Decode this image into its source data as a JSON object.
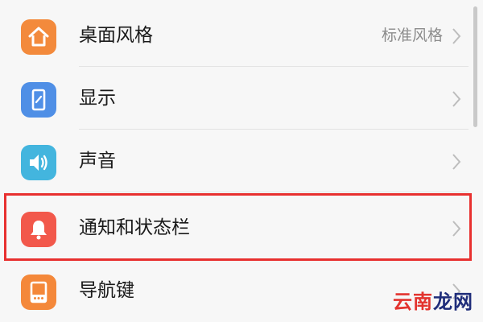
{
  "settings": {
    "items": [
      {
        "label": "桌面风格",
        "value": "标准风格",
        "icon": "home-icon",
        "icon_color": "#f38a3c"
      },
      {
        "label": "显示",
        "value": "",
        "icon": "display-icon",
        "icon_color": "#4f8fe6"
      },
      {
        "label": "声音",
        "value": "",
        "icon": "speaker-icon",
        "icon_color": "#43b5de"
      },
      {
        "label": "通知和状态栏",
        "value": "",
        "icon": "bell-icon",
        "icon_color": "#f2584b"
      },
      {
        "label": "导航键",
        "value": "",
        "icon": "navigation-keys-icon",
        "icon_color": "#f4883a"
      }
    ]
  },
  "highlight": {
    "color": "#e8302f",
    "target": "通知和状态栏"
  },
  "watermark": {
    "part1": "云南",
    "part2": "龙网",
    "color1": "#e3342f",
    "color2": "#1f2d7a"
  }
}
